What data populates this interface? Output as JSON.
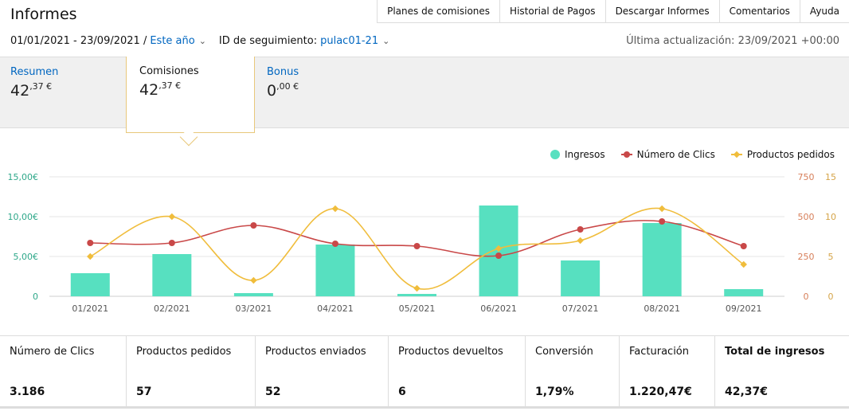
{
  "header": {
    "title": "Informes"
  },
  "topnav": [
    "Planes de comisiones",
    "Historial de Pagos",
    "Descargar Informes",
    "Comentarios",
    "Ayuda"
  ],
  "filters": {
    "date_range": "01/01/2021 - 23/09/2021 /",
    "period": "Este año",
    "tracking_label": "ID de seguimiento:",
    "tracking_id": "pulac01-21",
    "last_updated": "Última actualización: 23/09/2021 +00:00"
  },
  "summary": {
    "resumen": {
      "label": "Resumen",
      "int": "42",
      "dec": ",37 €"
    },
    "comisiones": {
      "label": "Comisiones",
      "int": "42",
      "dec": ",37 €"
    },
    "bonus": {
      "label": "Bonus",
      "int": "0",
      "dec": ",00 €"
    }
  },
  "colors": {
    "ingresos": "#57e0c0",
    "clics": "#c94848",
    "pedidos": "#f0bd3c",
    "link": "#0066c0"
  },
  "chart_data": {
    "type": "bar",
    "categories": [
      "01/2021",
      "02/2021",
      "03/2021",
      "04/2021",
      "05/2021",
      "06/2021",
      "07/2021",
      "08/2021",
      "09/2021"
    ],
    "series": [
      {
        "name": "Ingresos",
        "type": "bar",
        "axis": "left",
        "values": [
          2.9,
          5.3,
          0.4,
          6.5,
          0.3,
          11.4,
          4.5,
          9.2,
          0.9
        ]
      },
      {
        "name": "Número de Clics",
        "type": "line",
        "axis": "right",
        "values": [
          335,
          335,
          445,
          330,
          315,
          255,
          420,
          470,
          315
        ]
      },
      {
        "name": "Productos pedidos",
        "type": "line",
        "axis": "right2",
        "values": [
          5,
          10,
          2,
          11,
          1,
          6,
          7,
          11,
          4
        ]
      }
    ],
    "left_axis": {
      "ticks": [
        "0",
        "5,00€",
        "10,00€",
        "15,00€"
      ],
      "ylim": [
        0,
        15
      ]
    },
    "right_axis": {
      "ticks": [
        "0",
        "250",
        "500",
        "750"
      ],
      "ylim": [
        0,
        750
      ]
    },
    "right2_axis": {
      "ticks": [
        "0",
        "5",
        "10",
        "15"
      ],
      "ylim": [
        0,
        15
      ]
    },
    "legend": [
      "Ingresos",
      "Número de Clics",
      "Productos pedidos"
    ],
    "legend_position": "top-right",
    "grid": true
  },
  "metrics": [
    {
      "label": "Número de Clics",
      "value": "3.186"
    },
    {
      "label": "Productos pedidos",
      "value": "57"
    },
    {
      "label": "Productos enviados",
      "value": "52"
    },
    {
      "label": "Productos devueltos",
      "value": "6"
    },
    {
      "label": "Conversión",
      "value": "1,79%"
    },
    {
      "label": "Facturación",
      "value": "1.220,47€"
    },
    {
      "label": "Total de ingresos",
      "value": "42,37€"
    }
  ]
}
